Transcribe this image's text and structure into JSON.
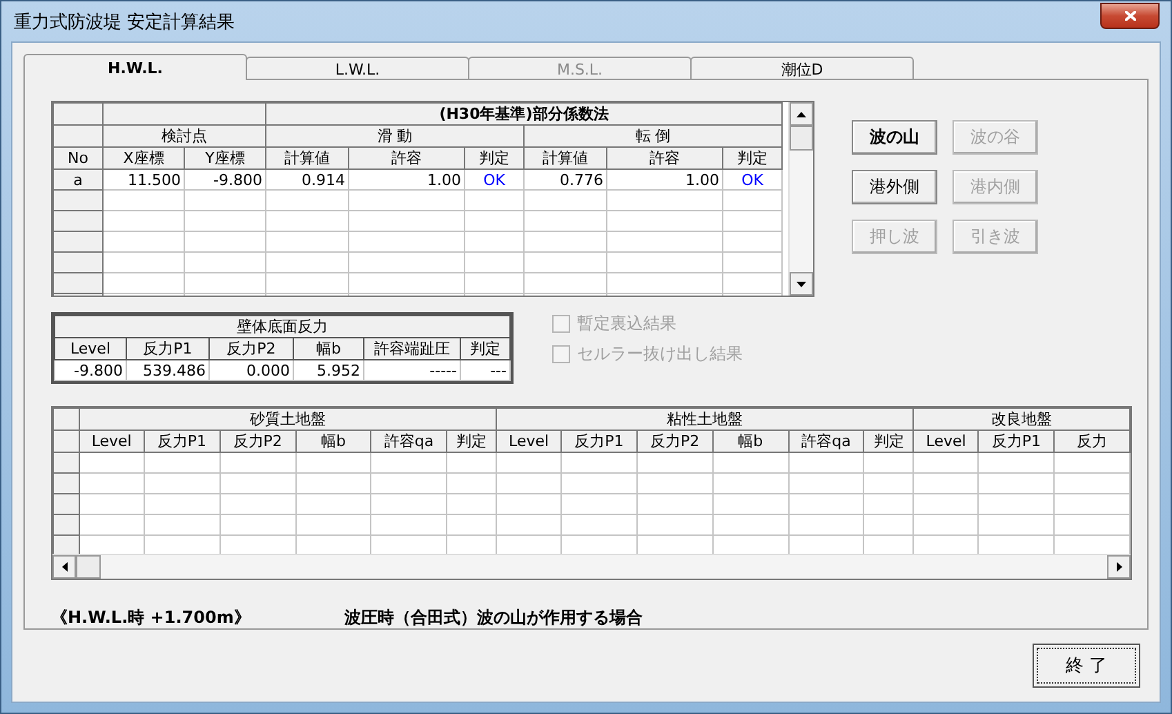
{
  "window": {
    "title": "重力式防波堤 安定計算結果"
  },
  "tabs": [
    {
      "label": "H.W.L.",
      "selected": true,
      "disabled": false
    },
    {
      "label": "L.W.L.",
      "selected": false,
      "disabled": false
    },
    {
      "label": "M.S.L.",
      "selected": false,
      "disabled": true
    },
    {
      "label": "潮位D",
      "selected": false,
      "disabled": false
    }
  ],
  "result_table": {
    "title": "(H30年基準)部分係数法",
    "key_column": "No",
    "groups": [
      {
        "label": "検討点",
        "columns": [
          {
            "label": "X座標",
            "kind": "number"
          },
          {
            "label": "Y座標",
            "kind": "number"
          }
        ]
      },
      {
        "label": "滑 動",
        "columns": [
          {
            "label": "計算値",
            "kind": "number"
          },
          {
            "label": "許容",
            "kind": "number"
          },
          {
            "label": "判定",
            "kind": "judge"
          }
        ]
      },
      {
        "label": "転 倒",
        "columns": [
          {
            "label": "計算値",
            "kind": "number"
          },
          {
            "label": "許容",
            "kind": "number"
          },
          {
            "label": "判定",
            "kind": "judge"
          }
        ]
      }
    ],
    "rows": [
      {
        "key": "a",
        "cells": [
          "11.500",
          "-9.800",
          "0.914",
          "1.00",
          "OK",
          "0.776",
          "1.00",
          "OK"
        ]
      }
    ]
  },
  "buttons": [
    {
      "label": "波の山",
      "selected": true,
      "disabled": false
    },
    {
      "label": "波の谷",
      "selected": false,
      "disabled": true
    },
    {
      "label": "港外側",
      "selected": false,
      "disabled": false
    },
    {
      "label": "港内側",
      "selected": false,
      "disabled": true
    },
    {
      "label": "押し波",
      "selected": false,
      "disabled": true
    },
    {
      "label": "引き波",
      "selected": false,
      "disabled": true
    }
  ],
  "reaction_table": {
    "title": "壁体底面反力",
    "columns": [
      "Level",
      "反力P1",
      "反力P2",
      "幅b",
      "許容端趾圧",
      "判定"
    ],
    "rows": [
      [
        "-9.800",
        "539.486",
        "0.000",
        "5.952",
        "-----",
        "---"
      ]
    ]
  },
  "options": [
    {
      "label": "暫定裏込結果",
      "checked": false,
      "disabled": true
    },
    {
      "label": "セルラー抜け出し結果",
      "checked": false,
      "disabled": true
    }
  ],
  "ground_table": {
    "groups": [
      {
        "label": "砂質土地盤",
        "columns": [
          "Level",
          "反力P1",
          "反力P2",
          "幅b",
          "許容qa",
          "判定"
        ]
      },
      {
        "label": "粘性土地盤",
        "columns": [
          "Level",
          "反力P1",
          "反力P2",
          "幅b",
          "許容qa",
          "判定"
        ]
      },
      {
        "label": "改良地盤",
        "columns": [
          "Level",
          "反力P1",
          "反力"
        ]
      }
    ]
  },
  "tide_label": "《H.W.L.時 +1.700m》",
  "case_label": "波圧時（合田式）波の山が作用する場合",
  "close_button": "終 了"
}
